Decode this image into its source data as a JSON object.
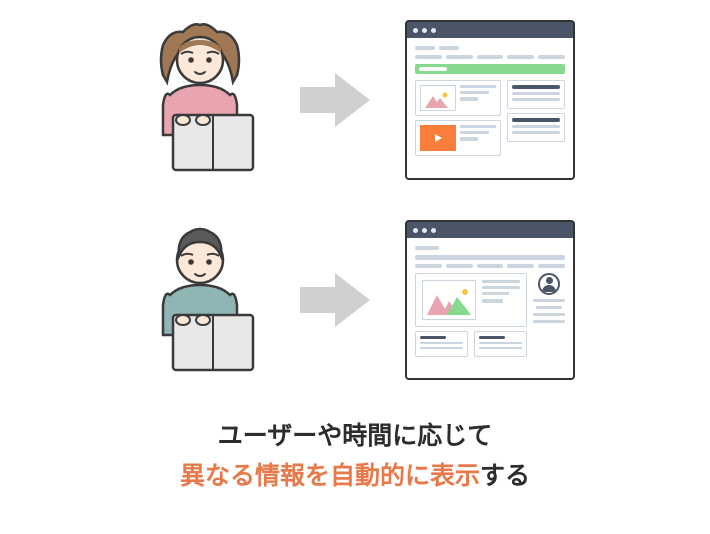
{
  "caption": {
    "line1": "ユーザーや時間に応じて",
    "line2_highlight": "異なる情報を自動的に表示",
    "line2_rest": "する"
  }
}
